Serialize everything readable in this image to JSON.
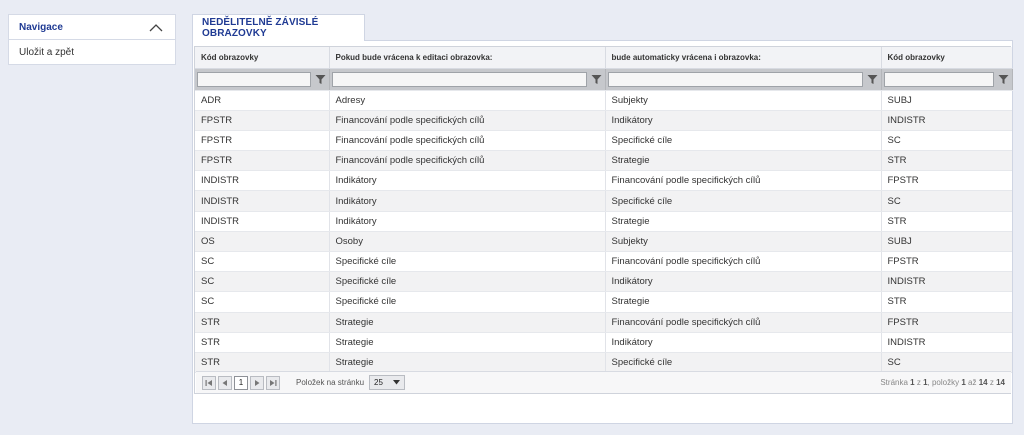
{
  "nav": {
    "title": "Navigace",
    "items": [
      "Uložit a zpět"
    ]
  },
  "tab": {
    "label": "NEDĚLITELNĚ ZÁVISLÉ OBRAZOVKY"
  },
  "table": {
    "headers": [
      "Kód obrazovky",
      "Pokud bude vrácena k editaci obrazovka:",
      "bude automaticky vrácena i obrazovka:",
      "Kód obrazovky"
    ],
    "rows": [
      [
        "ADR",
        "Adresy",
        "Subjekty",
        "SUBJ"
      ],
      [
        "FPSTR",
        "Financování podle specifických cílů",
        "Indikátory",
        "INDISTR"
      ],
      [
        "FPSTR",
        "Financování podle specifických cílů",
        "Specifické cíle",
        "SC"
      ],
      [
        "FPSTR",
        "Financování podle specifických cílů",
        "Strategie",
        "STR"
      ],
      [
        "INDISTR",
        "Indikátory",
        "Financování podle specifických cílů",
        "FPSTR"
      ],
      [
        "INDISTR",
        "Indikátory",
        "Specifické cíle",
        "SC"
      ],
      [
        "INDISTR",
        "Indikátory",
        "Strategie",
        "STR"
      ],
      [
        "OS",
        "Osoby",
        "Subjekty",
        "SUBJ"
      ],
      [
        "SC",
        "Specifické cíle",
        "Financování podle specifických cílů",
        "FPSTR"
      ],
      [
        "SC",
        "Specifické cíle",
        "Indikátory",
        "INDISTR"
      ],
      [
        "SC",
        "Specifické cíle",
        "Strategie",
        "STR"
      ],
      [
        "STR",
        "Strategie",
        "Financování podle specifických cílů",
        "FPSTR"
      ],
      [
        "STR",
        "Strategie",
        "Indikátory",
        "INDISTR"
      ],
      [
        "STR",
        "Strategie",
        "Specifické cíle",
        "SC"
      ]
    ]
  },
  "pager": {
    "current_page": "1",
    "page_size_label": "Položek na stránku",
    "page_size": "25",
    "info_prefix": "Stránka",
    "info_page": "1",
    "info_of": "z",
    "info_pages": "1",
    "info_items": ", položky",
    "info_from": "1",
    "info_to_word": "až",
    "info_to": "14",
    "info_total_word": "z",
    "info_total": "14"
  },
  "icons": {
    "collapse": "chevron-up-icon",
    "filter": "filter-funnel-icon",
    "first": "first-page-icon",
    "prev": "prev-page-icon",
    "next": "next-page-icon",
    "last": "last-page-icon",
    "dropdown": "dropdown-caret-icon"
  },
  "colors": {
    "accent": "#1f3a93",
    "background": "#e9ecf4",
    "filter_row": "#c6c8cc"
  }
}
